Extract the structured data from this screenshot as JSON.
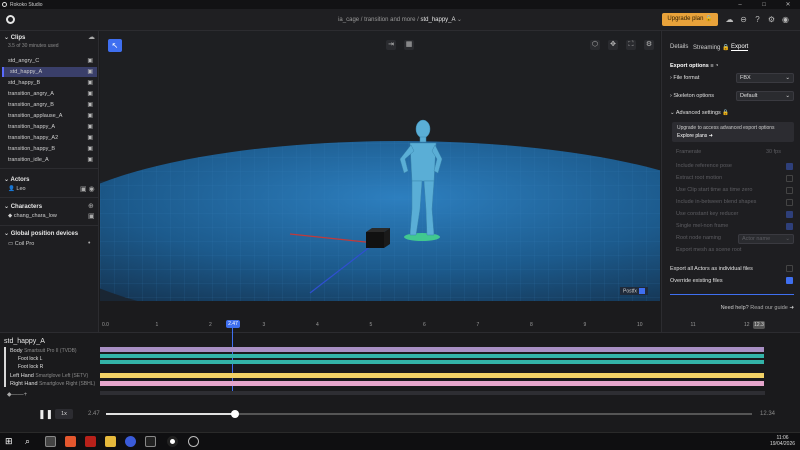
{
  "app": {
    "window_title": "Rokoko Studio",
    "breadcrumb_prefix": "ia_cage / transition and more / ",
    "breadcrumb_current": "std_happy_A",
    "upgrade_label": "Upgrade plan"
  },
  "left": {
    "clips_title": "Clips",
    "minutes_used": "3.5 of 30 minutes used",
    "clips": [
      "std_angry_C",
      "std_happy_A",
      "std_happy_B",
      "transition_angry_A",
      "transition_angry_B",
      "transition_applause_A",
      "transition_happy_A",
      "transition_happy_A2",
      "transition_happy_B",
      "transition_idle_A"
    ],
    "selected_index": 1,
    "actors_title": "Actors",
    "actor": "Leo",
    "characters_title": "Characters",
    "character": "chang_chara_low",
    "gpd_title": "Global position devices",
    "device": "Coil Pro"
  },
  "viewport": {
    "postfx_label": "Postfx"
  },
  "right": {
    "tabs": [
      "Details",
      "Streaming",
      "Export"
    ],
    "active_tab": "Export",
    "export_options_title": "Export options",
    "file_format_label": "File format",
    "file_format_value": "FBX",
    "skeleton_options_label": "Skeleton options",
    "skeleton_options_value": "Default",
    "advanced_title": "Advanced settings",
    "upgrade_text": "Upgrade to access advanced export options",
    "explore_plans": "Explore plans",
    "framerate_label": "Framerate",
    "framerate_value": "30 fps",
    "disabled_options": [
      "Include reference pose",
      "Extract root motion",
      "Use Clip start time as time zero",
      "Include in-between blend shapes",
      "Use constant key reducer",
      "Single mel-non frame",
      "Root node naming",
      "Export mesh as scene root"
    ],
    "root_naming_placeholder": "Actor name",
    "export_all_label": "Export all Actors as individual files",
    "override_label": "Override existing files",
    "help_prefix": "Need help?",
    "help_link": "Read our guide"
  },
  "timeline": {
    "clip_name": "std_happy_A",
    "ticks": [
      "0.0",
      "1",
      "2",
      "3",
      "4",
      "5",
      "6",
      "7",
      "8",
      "9",
      "10",
      "11",
      "12"
    ],
    "playhead_label": "2.47",
    "end_label": "12.3",
    "tracks": [
      {
        "name": "Body",
        "device": "Smartsuit Pro II (TVDB)"
      },
      {
        "name": "Foot lock L",
        "device": ""
      },
      {
        "name": "Foot lock R",
        "device": ""
      },
      {
        "name": "Left Hand",
        "device": "Smartglove Left (SETV)"
      },
      {
        "name": "Right Hand",
        "device": "Smartglove Right (SBHL)"
      }
    ],
    "speed": "1x",
    "current_time": "2.47",
    "total_time": "12.34",
    "progress": 0.2
  },
  "taskbar": {
    "time": "11:06",
    "date": "19/04/2026"
  },
  "colors": {
    "accent": "#3f6ff0",
    "upgrade": "#e8a23a",
    "track_purple": "#a88fc4",
    "track_teal": "#33b3a8",
    "track_yellow": "#f2d266",
    "track_pink": "#e6a6cc",
    "floor": "#1f5f8f"
  }
}
